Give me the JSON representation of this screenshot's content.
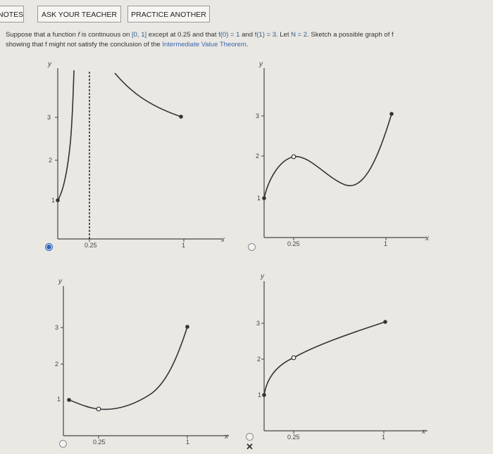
{
  "toolbar": {
    "notes_label": "NOTES",
    "ask_teacher_label": "ASK YOUR TEACHER",
    "practice_another_label": "PRACTICE ANOTHER"
  },
  "question": {
    "line1_a": "Suppose that a function ",
    "f": "f",
    "line1_b": " is continuous on ",
    "interval": "[0, 1]",
    "line1_c": " except at 0.25 and that ",
    "f0": "f(0) = 1",
    "and": " and ",
    "f1": "f(1) = 3",
    "let": ". Let ",
    "N": "N = 2",
    "line1_d": ". Sketch a possible graph of f",
    "line2_a": "showing that f might not satisfy the conclusion of the ",
    "ivt": "Intermediate Value Theorem",
    "line2_b": "."
  },
  "graphs": [
    {
      "id": "A",
      "selected": true,
      "y_label": "y",
      "x_label": "x",
      "ticks_y": [
        "1",
        "2",
        "3"
      ],
      "ticks_x": [
        "0.25",
        "1"
      ]
    },
    {
      "id": "B",
      "selected": false,
      "y_label": "y",
      "x_label": "x",
      "ticks_y": [
        "1",
        "2",
        "3"
      ],
      "ticks_x": [
        "0.25",
        "1"
      ]
    },
    {
      "id": "C",
      "selected": false,
      "y_label": "y",
      "x_label": "x",
      "ticks_y": [
        "1",
        "2",
        "3"
      ],
      "ticks_x": [
        "0.25",
        "1"
      ]
    },
    {
      "id": "D",
      "selected": false,
      "y_label": "y",
      "x_label": "x",
      "ticks_y": [
        "1",
        "2",
        "3"
      ],
      "ticks_x": [
        "0.25",
        "1"
      ]
    }
  ],
  "result": {
    "mark": "✕"
  },
  "colors": {
    "selected_radio": "#2e63b8",
    "link_text": "#3a66b0"
  }
}
